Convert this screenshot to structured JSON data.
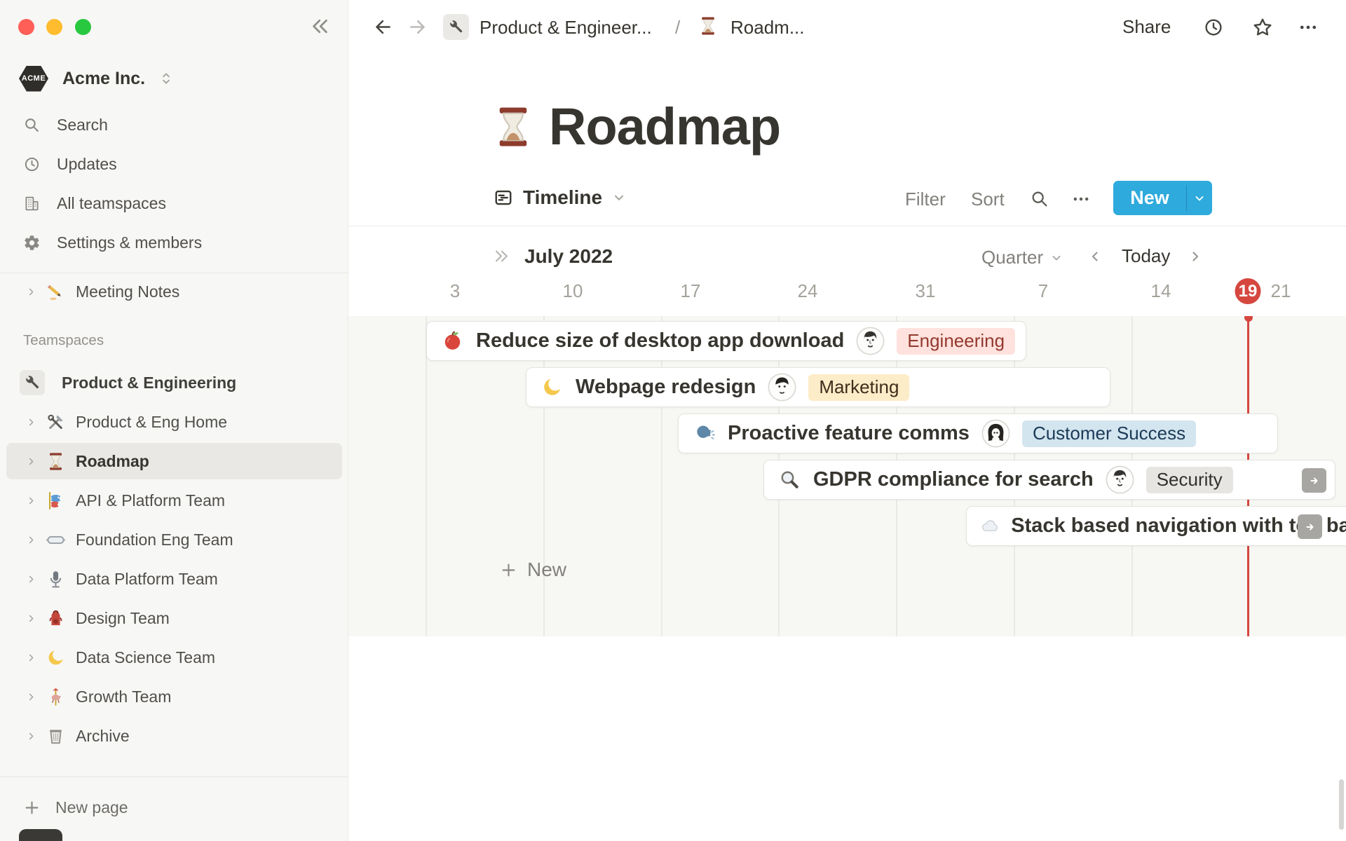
{
  "colors": {
    "accent_blue": "#2EAADC",
    "today_red": "#D5473F",
    "sidebar_bg": "#F7F7F5",
    "tag_red_bg": "#FFE2DD",
    "tag_red_text": "#93392F",
    "tag_yellow_bg": "#FDECC8",
    "tag_yellow_text": "#402C1B",
    "tag_blue_bg": "#D3E5EF",
    "tag_blue_text": "#1B3A57",
    "tag_gray_bg": "#E6E5E2",
    "tag_gray_text": "#32302C"
  },
  "sidebar": {
    "workspace": {
      "logo_text": "ACME",
      "name": "Acme Inc."
    },
    "top_items": [
      {
        "icon": "search-icon",
        "label": "Search"
      },
      {
        "icon": "clock-icon",
        "label": "Updates"
      },
      {
        "icon": "building-icon",
        "label": "All teamspaces"
      },
      {
        "icon": "gear-icon",
        "label": "Settings & members"
      }
    ],
    "shared_pages": [
      {
        "icon": "writing-hand-emoji",
        "label": "Meeting Notes"
      }
    ],
    "teamspaces_header": "Teamspaces",
    "teamspaces": [
      {
        "icon": "wrench-emoji",
        "label": "Product & Engineering"
      },
      {
        "icon": "hammer-and-wrench-emoji",
        "label": "Product & Eng Home"
      },
      {
        "icon": "hourglass-emoji",
        "label": "Roadmap",
        "selected": true
      },
      {
        "icon": "carp-streamer-emoji",
        "label": "API & Platform Team"
      },
      {
        "icon": "goggles-emoji",
        "label": "Foundation Eng Team"
      },
      {
        "icon": "studio-microphone-emoji",
        "label": "Data Platform Team"
      },
      {
        "icon": "backpack-emoji",
        "label": "Design Team"
      },
      {
        "icon": "crescent-moon-emoji",
        "label": "Data Science Team"
      },
      {
        "icon": "carousel-horse-emoji",
        "label": "Growth Team"
      },
      {
        "icon": "wastebasket-emoji",
        "label": "Archive"
      }
    ],
    "new_page_label": "New page"
  },
  "topbar": {
    "breadcrumb": {
      "first": "Product & Engineer...",
      "separator": "/",
      "second": "Roadm..."
    },
    "share_label": "Share"
  },
  "page": {
    "icon": "hourglass-emoji",
    "title": "Roadmap"
  },
  "view_bar": {
    "view_label": "Timeline",
    "filter_label": "Filter",
    "sort_label": "Sort",
    "new_button_label": "New"
  },
  "timeline": {
    "month_label": "July 2022",
    "scale_label": "Quarter",
    "today_label": "Today",
    "dates": [
      "3",
      "10",
      "17",
      "24",
      "31",
      "7",
      "14",
      "19",
      "21"
    ],
    "tasks": [
      {
        "emoji": "apple",
        "title": "Reduce size of desktop app download",
        "tag": "Engineering"
      },
      {
        "emoji": "crescent-moon",
        "title": "Webpage redesign",
        "tag": "Marketing"
      },
      {
        "emoji": "speaking-head",
        "title": "Proactive feature comms",
        "tag": "Customer Success"
      },
      {
        "emoji": "magnifying-glass",
        "title": "GDPR compliance for search",
        "tag": "Security"
      },
      {
        "emoji": "cloud",
        "title": "Stack based navigation with top bar",
        "tag": ""
      }
    ],
    "add_row_label": "New"
  }
}
